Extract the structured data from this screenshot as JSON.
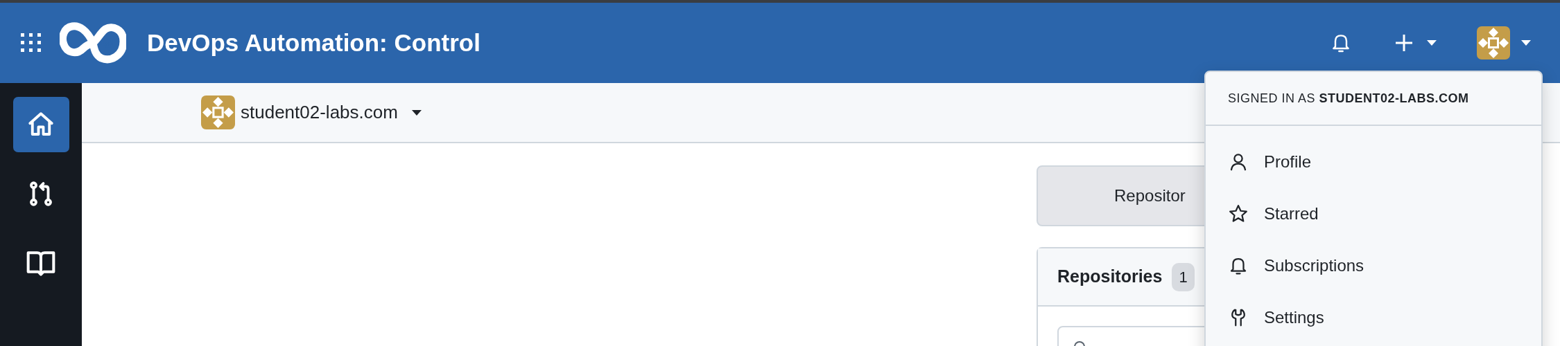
{
  "header": {
    "title": "DevOps Automation: Control"
  },
  "sidebar": {
    "items": [
      {
        "kind": "home",
        "selected": true
      },
      {
        "kind": "pulls",
        "selected": false
      },
      {
        "kind": "book",
        "selected": false
      }
    ]
  },
  "account_switcher": {
    "label": "student02-labs.com"
  },
  "main": {
    "repository_button": "Repositor",
    "repositories_card": {
      "title": "Repositories",
      "count": "1"
    }
  },
  "user_menu": {
    "header": "SIGNED IN AS **STUDENT02-LABS.COM**",
    "items": [
      {
        "kind": "profile",
        "label": "Profile"
      },
      {
        "kind": "star",
        "label": "Starred"
      },
      {
        "kind": "bell",
        "label": "Subscriptions"
      },
      {
        "kind": "settings",
        "label": "Settings"
      }
    ]
  }
}
